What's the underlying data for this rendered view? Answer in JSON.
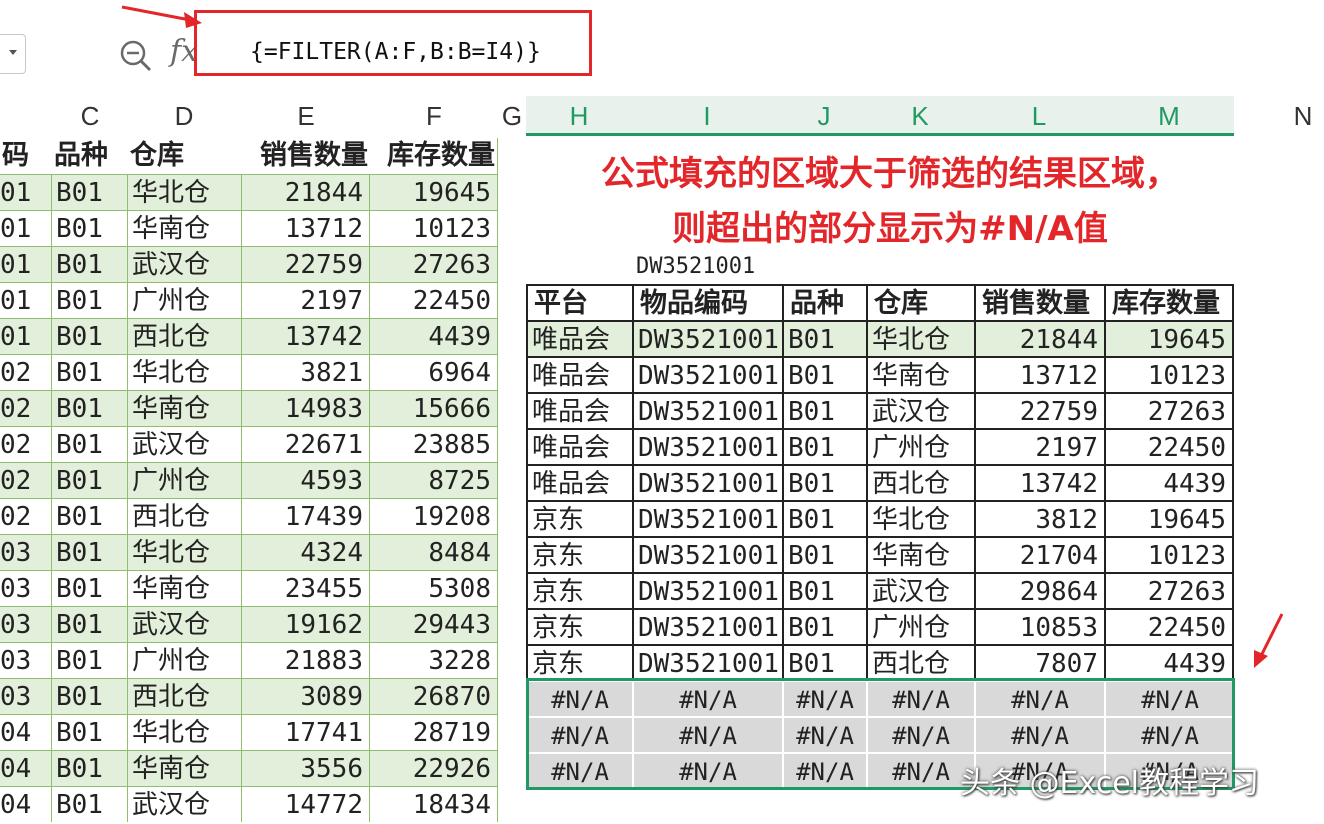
{
  "formula_bar": {
    "formula": "{=FILTER(A:F,B:B=I4)}",
    "fx_label": "fx"
  },
  "columns": {
    "left": [
      "C",
      "D",
      "E",
      "F",
      "G"
    ],
    "right": [
      "H",
      "I",
      "J",
      "K",
      "L",
      "M",
      "N"
    ]
  },
  "left_table": {
    "headers": [
      "码",
      "品种",
      "仓库",
      "销售数量",
      "库存数量"
    ],
    "rows": [
      [
        "01",
        "B01",
        "华北仓",
        "21844",
        "19645"
      ],
      [
        "01",
        "B01",
        "华南仓",
        "13712",
        "10123"
      ],
      [
        "01",
        "B01",
        "武汉仓",
        "22759",
        "27263"
      ],
      [
        "01",
        "B01",
        "广州仓",
        "2197",
        "22450"
      ],
      [
        "01",
        "B01",
        "西北仓",
        "13742",
        "4439"
      ],
      [
        "02",
        "B01",
        "华北仓",
        "3821",
        "6964"
      ],
      [
        "02",
        "B01",
        "华南仓",
        "14983",
        "15666"
      ],
      [
        "02",
        "B01",
        "武汉仓",
        "22671",
        "23885"
      ],
      [
        "02",
        "B01",
        "广州仓",
        "4593",
        "8725"
      ],
      [
        "02",
        "B01",
        "西北仓",
        "17439",
        "19208"
      ],
      [
        "03",
        "B01",
        "华北仓",
        "4324",
        "8484"
      ],
      [
        "03",
        "B01",
        "华南仓",
        "23455",
        "5308"
      ],
      [
        "03",
        "B01",
        "武汉仓",
        "19162",
        "29443"
      ],
      [
        "03",
        "B01",
        "广州仓",
        "21883",
        "3228"
      ],
      [
        "03",
        "B01",
        "西北仓",
        "3089",
        "26870"
      ],
      [
        "04",
        "B01",
        "华北仓",
        "17741",
        "28719"
      ],
      [
        "04",
        "B01",
        "华南仓",
        "3556",
        "22926"
      ],
      [
        "04",
        "B01",
        "武汉仓",
        "14772",
        "18434"
      ]
    ]
  },
  "annotation": {
    "line1": "公式填充的区域大于筛选的结果区域，",
    "line2": "则超出的部分显示为#N/A值"
  },
  "lookup_value": "DW3521001",
  "result_table": {
    "headers": [
      "平台",
      "物品编码",
      "品种",
      "仓库",
      "销售数量",
      "库存数量"
    ],
    "rows": [
      [
        "唯品会",
        "DW3521001",
        "B01",
        "华北仓",
        "21844",
        "19645"
      ],
      [
        "唯品会",
        "DW3521001",
        "B01",
        "华南仓",
        "13712",
        "10123"
      ],
      [
        "唯品会",
        "DW3521001",
        "B01",
        "武汉仓",
        "22759",
        "27263"
      ],
      [
        "唯品会",
        "DW3521001",
        "B01",
        "广州仓",
        "2197",
        "22450"
      ],
      [
        "唯品会",
        "DW3521001",
        "B01",
        "西北仓",
        "13742",
        "4439"
      ],
      [
        "京东",
        "DW3521001",
        "B01",
        "华北仓",
        "3812",
        "19645"
      ],
      [
        "京东",
        "DW3521001",
        "B01",
        "华南仓",
        "21704",
        "10123"
      ],
      [
        "京东",
        "DW3521001",
        "B01",
        "武汉仓",
        "29864",
        "27263"
      ],
      [
        "京东",
        "DW3521001",
        "B01",
        "广州仓",
        "10853",
        "22450"
      ],
      [
        "京东",
        "DW3521001",
        "B01",
        "西北仓",
        "7807",
        "4439"
      ]
    ],
    "na_rows": [
      [
        "#N/A",
        "#N/A",
        "#N/A",
        "#N/A",
        "#N/A",
        "#N/A"
      ],
      [
        "#N/A",
        "#N/A",
        "#N/A",
        "#N/A",
        "#N/A",
        "#N/A"
      ],
      [
        "#N/A",
        "#N/A",
        "#N/A",
        "#N/A",
        "#N/A",
        "#N/A"
      ]
    ]
  },
  "watermark": "头条 @Excel教程学习",
  "colors": {
    "accent_green": "#1f9a62",
    "highlight_red": "#e3262a",
    "row_green": "#e2efda",
    "na_fill": "#d9d9d9"
  }
}
